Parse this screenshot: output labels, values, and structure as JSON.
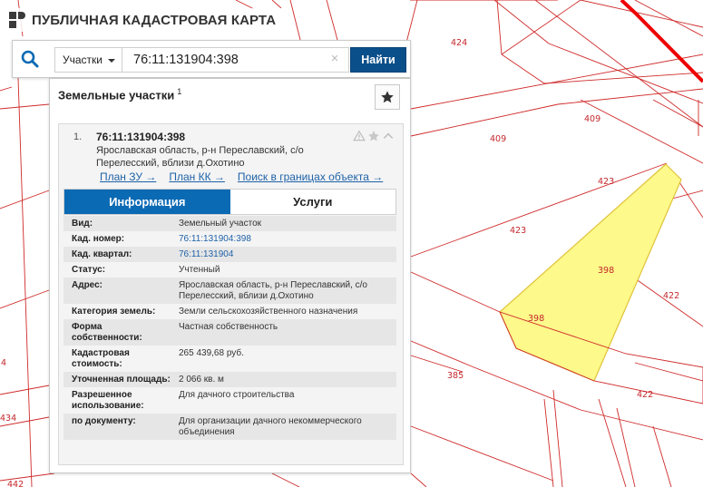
{
  "app": {
    "title": "ПУБЛИЧНАЯ КАДАСТРОВАЯ КАРТА"
  },
  "search": {
    "type_label": "Участки",
    "query": "76:11:131904:398",
    "button_label": "Найти"
  },
  "results": {
    "title": "Земельные участки",
    "count": "1",
    "item": {
      "number": "1.",
      "cad_number": "76:11:131904:398",
      "address": "Ярославская область, р-н Переславский, с/о Перелесский, вблизи д.Охотино",
      "links": [
        "План ЗУ →",
        "План КК →",
        "Поиск в границах объекта →"
      ],
      "tabs": [
        "Информация",
        "Услуги"
      ],
      "attributes": [
        {
          "label": "Вид:",
          "value": "Земельный участок"
        },
        {
          "label": "Кад. номер:",
          "value": "76:11:131904:398",
          "link": true
        },
        {
          "label": "Кад. квартал:",
          "value": "76:11:131904",
          "link": true
        },
        {
          "label": "Статус:",
          "value": "Учтенный"
        },
        {
          "label": "Адрес:",
          "value": "Ярославская область, р-н Переславский, с/о Перелесский, вблизи д.Охотино"
        },
        {
          "label": "Категория земель:",
          "value": "Земли сельскохозяйственного назначения"
        },
        {
          "label": "Форма собственности:",
          "value": "Частная собственность"
        },
        {
          "label": "Кадастровая стоимость:",
          "value": "265 439,68 руб."
        },
        {
          "label": "Уточненная площадь:",
          "value": "2 066 кв. м"
        },
        {
          "label": "Разрешенное использование:",
          "value": "Для дачного строительства"
        },
        {
          "label": "по документу:",
          "value": "Для организации дачного некоммерческого объединения"
        }
      ]
    }
  },
  "map": {
    "parcel_labels": [
      "424",
      "409",
      "409",
      "423",
      "423",
      "398",
      "398",
      "422",
      "385",
      "422",
      "4",
      "434",
      "442"
    ],
    "colors": {
      "boundary": "#d02a2a",
      "selected_fill": "#fdf98a",
      "selected_stroke": "#e0c23a",
      "border_line": "#ee0000"
    }
  }
}
